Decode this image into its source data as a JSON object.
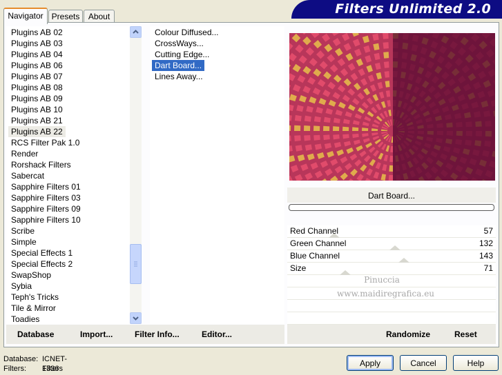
{
  "app": {
    "title": "Filters Unlimited 2.0"
  },
  "tabs": [
    {
      "label": "Navigator",
      "active": true
    },
    {
      "label": "Presets",
      "active": false
    },
    {
      "label": "About",
      "active": false
    }
  ],
  "categories": {
    "items": [
      "Plugins AB 02",
      "Plugins AB 03",
      "Plugins AB 04",
      "Plugins AB 06",
      "Plugins AB 07",
      "Plugins AB 08",
      "Plugins AB 09",
      "Plugins AB 10",
      "Plugins AB 21",
      "Plugins AB 22",
      "RCS Filter Pak 1.0",
      "Render",
      "Rorshack Filters",
      "Sabercat",
      "Sapphire Filters 01",
      "Sapphire Filters 03",
      "Sapphire Filters 09",
      "Sapphire Filters 10",
      "Scribe",
      "Simple",
      "Special Effects 1",
      "Special Effects 2",
      "SwapShop",
      "Sybia",
      "Teph's Tricks",
      "Tile & Mirror",
      "Toadies"
    ],
    "selected": "Plugins AB 22"
  },
  "filters": {
    "items": [
      "Colour Diffused...",
      "CrossWays...",
      "Cutting Edge...",
      "Dart Board...",
      "Lines Away..."
    ],
    "selected": "Dart Board..."
  },
  "preview": {
    "filter_name": "Dart Board...",
    "watermark_line1": "Pinuccia",
    "watermark_line2": "www.maidiregrafica.eu",
    "colors": {
      "ring_a": "#e84f6e",
      "ring_b": "#e6c04a",
      "dark": "#5a0a32",
      "bg": "#b8365a"
    }
  },
  "parameters": [
    {
      "name": "Red Channel",
      "value": 57,
      "max": 255
    },
    {
      "name": "Green Channel",
      "value": 132,
      "max": 255
    },
    {
      "name": "Blue Channel",
      "value": 143,
      "max": 255
    },
    {
      "name": "Size",
      "value": 71,
      "max": 255
    }
  ],
  "toolbar": {
    "database": "Database",
    "import": "Import...",
    "filter_info": "Filter Info...",
    "editor": "Editor...",
    "randomize": "Randomize",
    "reset": "Reset"
  },
  "status": {
    "database_label": "Database:",
    "database_value": "ICNET-Filters",
    "filters_label": "Filters:",
    "filters_value": "1336"
  },
  "buttons": {
    "apply": "Apply",
    "cancel": "Cancel",
    "help": "Help"
  },
  "accent": "#316ac5"
}
